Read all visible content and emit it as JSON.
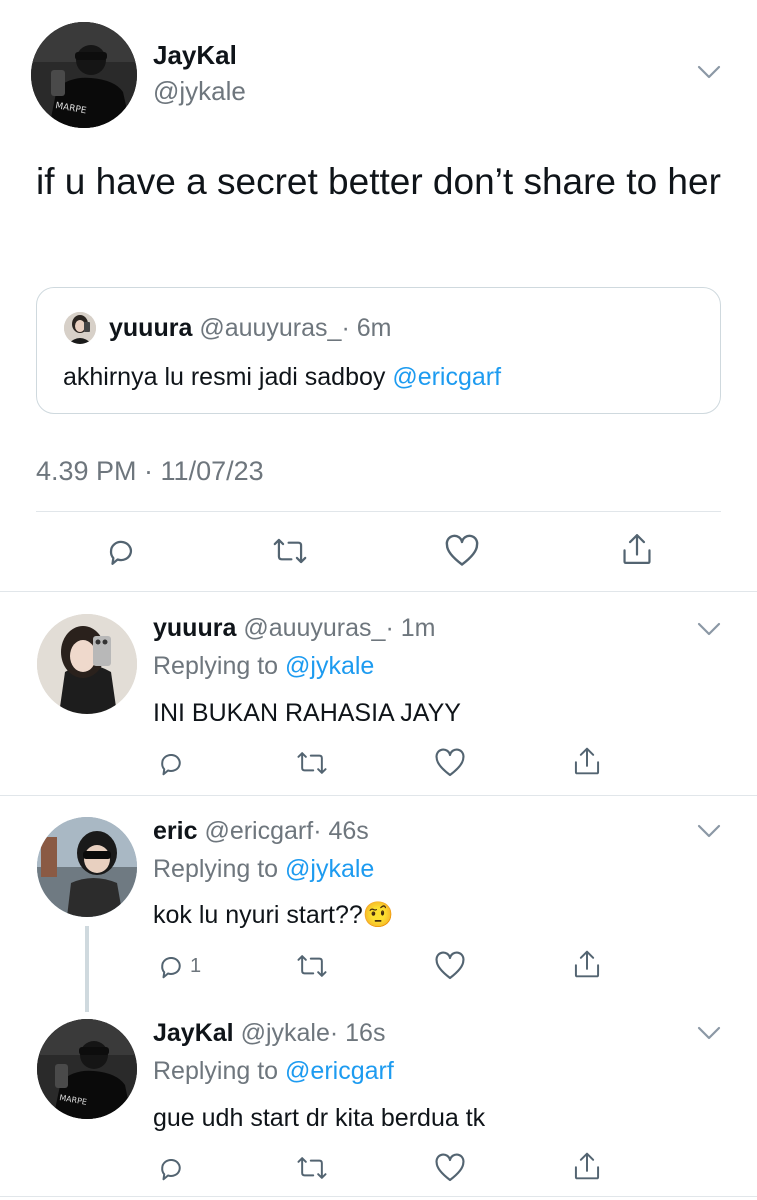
{
  "main_tweet": {
    "display_name": "JayKal",
    "handle": "@jykale",
    "text": "if u have a secret better don’t share to her",
    "timestamp": "4.39 PM · 11/07/23",
    "avatar_shirt_text": "MARPE"
  },
  "quoted_tweet": {
    "display_name": "yuuura",
    "handle": "@auuyuras_",
    "age": "· 6m",
    "text_prefix": "akhirnya lu resmi jadi sadboy ",
    "mention": "@ericgarf"
  },
  "replies": [
    {
      "display_name": "yuuura",
      "handle": "@auuyuras_",
      "age": "· 1m",
      "replying_prefix": "Replying to ",
      "replying_to": "@jykale",
      "text": "INI BUKAN RAHASIA JAYY",
      "reply_count": ""
    },
    {
      "display_name": "eric",
      "handle": "@ericgarf",
      "age": "· 46s",
      "replying_prefix": "Replying to ",
      "replying_to": "@jykale",
      "text": "kok lu nyuri start??",
      "emoji": "🤨",
      "reply_count": "1"
    },
    {
      "display_name": "JayKal",
      "handle": "@jykale",
      "age": "· 16s",
      "replying_prefix": "Replying to ",
      "replying_to": "@ericgarf",
      "text": "gue udh start dr kita berdua tk",
      "reply_count": ""
    }
  ],
  "icons": {
    "reply": "reply-icon",
    "retweet": "retweet-icon",
    "like": "like-icon",
    "share": "share-icon",
    "more": "chevron-down-icon"
  },
  "colors": {
    "text": "#0f1419",
    "secondary": "#6e767d",
    "link": "#1d9bf0",
    "divider": "#e1e6ea"
  }
}
